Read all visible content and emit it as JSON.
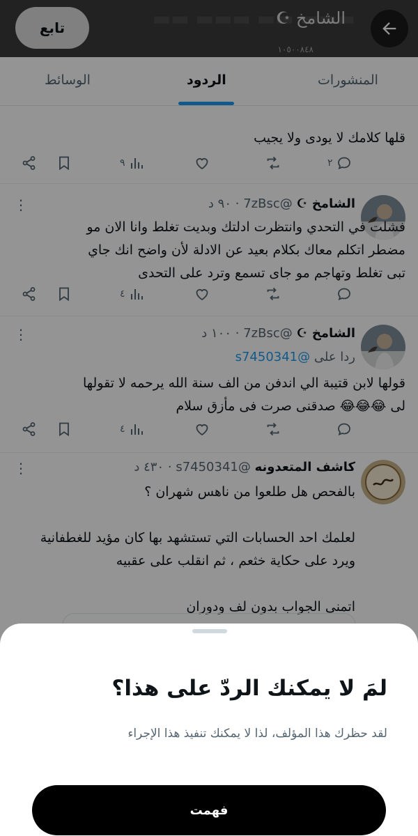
{
  "header": {
    "display_name": "الشامخ ☪",
    "count_text": "١٠٥٠٠٨٤٨",
    "follow_label": "تابع"
  },
  "tabs": [
    {
      "label": "المنشورات",
      "active": false
    },
    {
      "label": "الردود",
      "active": true
    },
    {
      "label": "الوسائط",
      "active": false
    }
  ],
  "posts": [
    {
      "text_lines": [
        "قلها كلامك لا يودى ولا يجيب"
      ],
      "replies": "٢",
      "views": "٩"
    },
    {
      "name": "الشامخ ☪",
      "handle": "@7zBsc",
      "time": "٩٠ د",
      "text_lines": [
        "فشلت في التحدي وانتظرت ادلتك وبديت تغلط وانا الان مو",
        "مضطر اتكلم معاك بكلام بعيد عن الادلة لأن واضح انك جاي",
        "تبى تغلط وتهاجم مو جاى تسمع وترد على التحدى"
      ],
      "views": "٤"
    },
    {
      "name": "الشامخ ☪",
      "handle": "@7zBsc",
      "time": "١٠٠ د",
      "replying_prefix": "ردا على",
      "replying_to": "@s7450341",
      "text_lines": [
        "قولها لابن قتيبة الي اندفن من الف سنة الله يرحمه لا تقولها",
        "لى 😂😂😂 صدقنى صرت فى مأزق سلام"
      ],
      "views": "٤"
    },
    {
      "name": "كاشف المتعدونه",
      "handle": "@s7450341",
      "time": "٤٣٠ د",
      "text_lines": [
        "بالفحص هل طلعوا من ناهس شهران ؟",
        "",
        "لعلمك احد الحسابات التي تستشهد بها كان مؤيد للغطفانية",
        "ويرد على حكاية خثعم ، ثم انقلب على عقبيه",
        "",
        "اتمنى الجواب بدون لف ودوران"
      ]
    }
  ],
  "sheet": {
    "title": "لمَ لا يمكنك الردّ على هذا؟",
    "body": "لقد حظرك هذا المؤلف، لذا لا يمكنك تنفيذ هذا الإجراء",
    "button_label": "فهمت"
  },
  "colors": {
    "accent": "#1d9bf0",
    "text_primary": "#0f1419",
    "text_secondary": "#536471",
    "header_bg": "#3c3c3c"
  },
  "icons": [
    "back-arrow-icon",
    "reply-icon",
    "retweet-icon",
    "like-icon",
    "views-icon",
    "bookmark-icon",
    "share-icon",
    "more-icon"
  ]
}
